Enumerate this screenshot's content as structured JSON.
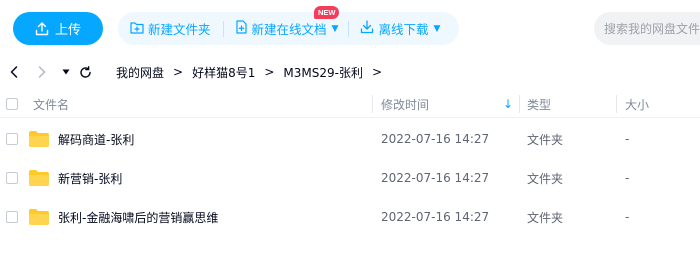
{
  "toolbar": {
    "upload_label": "上传",
    "new_folder_label": "新建文件夹",
    "new_doc_label": "新建在线文档",
    "new_badge": "NEW",
    "offline_download_label": "离线下载",
    "caret": "▼",
    "search_placeholder": "搜索我的网盘文件"
  },
  "nav": {
    "icons": [
      "back-icon",
      "forward-icon",
      "history-dropdown-icon",
      "refresh-icon"
    ]
  },
  "breadcrumb": {
    "items": [
      "我的网盘",
      "好样猫8号1",
      "M3MS29-张利"
    ],
    "separator": ">"
  },
  "table": {
    "columns": {
      "name": "文件名",
      "modified": "修改时间",
      "type": "类型",
      "size": "大小"
    },
    "sort_arrow": "↓",
    "rows": [
      {
        "name": "解码商道-张利",
        "modified": "2022-07-16 14:27",
        "type": "文件夹",
        "size": "-"
      },
      {
        "name": "新营销-张利",
        "modified": "2022-07-16 14:27",
        "type": "文件夹",
        "size": "-"
      },
      {
        "name": "张利-金融海啸后的营销赢思维",
        "modified": "2022-07-16 14:27",
        "type": "文件夹",
        "size": "-"
      }
    ]
  },
  "colors": {
    "accent": "#06a7ff",
    "accent_light_bg": "#eef8fe",
    "badge": "#f33d5b",
    "folder": "#ffca28"
  }
}
